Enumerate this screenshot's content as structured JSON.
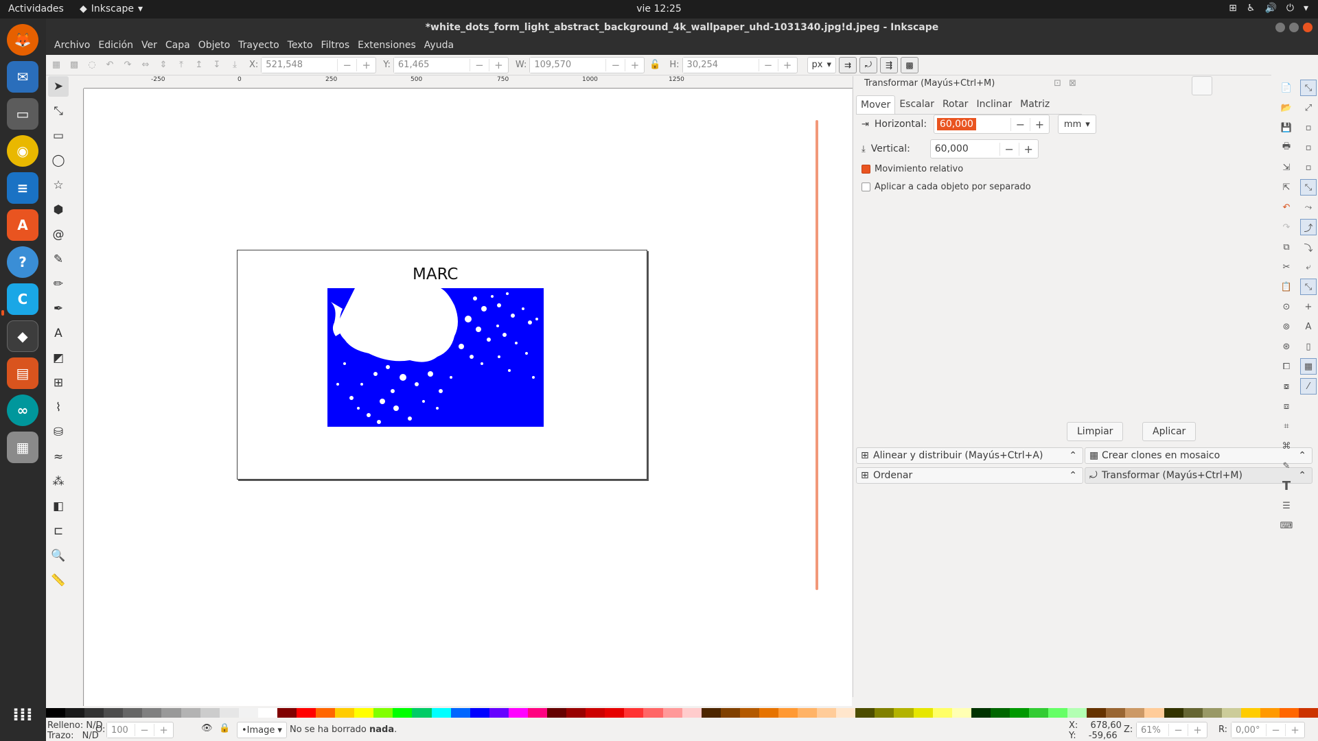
{
  "topbar": {
    "activities": "Actividades",
    "app_name": "Inkscape",
    "clock": "vie 12:25"
  },
  "dock": {
    "apps": [
      "firefox",
      "thunderbird",
      "files",
      "rhythmbox",
      "writer",
      "software",
      "help",
      "code",
      "inkscape",
      "impress",
      "arduino",
      "calculator",
      "show-apps"
    ]
  },
  "window": {
    "title": "*white_dots_form_light_abstract_background_4k_wallpaper_uhd-1031340.jpg!d.jpeg - Inkscape"
  },
  "menu": [
    "Archivo",
    "Edición",
    "Ver",
    "Capa",
    "Objeto",
    "Trayecto",
    "Texto",
    "Filtros",
    "Extensiones",
    "Ayuda"
  ],
  "toolbar": {
    "x_label": "X:",
    "x_value": "521,548",
    "y_label": "Y:",
    "y_value": "61,465",
    "w_label": "W:",
    "w_value": "109,570",
    "h_label": "H:",
    "h_value": "30,254",
    "unit": "px"
  },
  "ruler": {
    "ticks": [
      "-250",
      "0",
      "250",
      "500",
      "750",
      "1000",
      "1250"
    ]
  },
  "canvas": {
    "text": "MARC",
    "image_color": "#0000ff"
  },
  "transform_panel": {
    "title": "Transformar (Mayús+Ctrl+M)",
    "tabs": [
      "Mover",
      "Escalar",
      "Rotar",
      "Inclinar",
      "Matriz"
    ],
    "active_tab": "Mover",
    "horizontal_label": "Horizontal:",
    "horizontal_value": "60,000",
    "vertical_label": "Vertical:",
    "vertical_value": "60,000",
    "unit": "mm",
    "relative_label": "Movimiento relativo",
    "relative_checked": true,
    "each_label": "Aplicar a cada objeto por separado",
    "each_checked": false,
    "clear_button": "Limpiar",
    "apply_button": "Aplicar"
  },
  "docked": {
    "align": "Alinear y distribuir (Mayús+Ctrl+A)",
    "tile": "Crear clones en mosaico",
    "order": "Ordenar",
    "transform": "Transformar (Mayús+Ctrl+M)"
  },
  "status": {
    "fill_label": "Relleno:",
    "fill_value": "N/D",
    "stroke_label": "Trazo:",
    "stroke_value": "N/D",
    "opacity_label": "O:",
    "opacity_value": "100",
    "layer": "•Image",
    "message_prefix": "No se ha borrado ",
    "message_bold": "nada",
    "message_suffix": ".",
    "x_label": "X:",
    "x_value": "678,60",
    "y_label": "Y:",
    "y_value": "-59,66",
    "zoom_label": "Z:",
    "zoom_value": "61%",
    "rotation_label": "R:",
    "rotation_value": "0,00°"
  },
  "palette": [
    "#000000",
    "#1a1a1a",
    "#333333",
    "#4d4d4d",
    "#666666",
    "#808080",
    "#999999",
    "#b3b3b3",
    "#cccccc",
    "#e6e6e6",
    "#f2f2f2",
    "#ffffff",
    "#800000",
    "#ff0000",
    "#ff6600",
    "#ffcc00",
    "#ffff00",
    "#80ff00",
    "#00ff00",
    "#00cc66",
    "#00ffff",
    "#0066ff",
    "#0000ff",
    "#6600ff",
    "#ff00ff",
    "#ff0080",
    "#660000",
    "#990000",
    "#cc0000",
    "#e60000",
    "#ff3333",
    "#ff6666",
    "#ff9999",
    "#ffcccc",
    "#4d2600",
    "#804000",
    "#b35900",
    "#e67300",
    "#ff9933",
    "#ffb366",
    "#ffcc99",
    "#ffe6cc",
    "#4d4d00",
    "#808000",
    "#b3b300",
    "#e6e600",
    "#ffff66",
    "#ffffb3",
    "#003300",
    "#006600",
    "#009900",
    "#33cc33",
    "#66ff66",
    "#b3ffb3",
    "#663300",
    "#996633",
    "#cc9966",
    "#ffcc99",
    "#333300",
    "#666633",
    "#999966",
    "#cccc99",
    "#ffcc00",
    "#ff9900",
    "#ff6600",
    "#cc3300"
  ]
}
